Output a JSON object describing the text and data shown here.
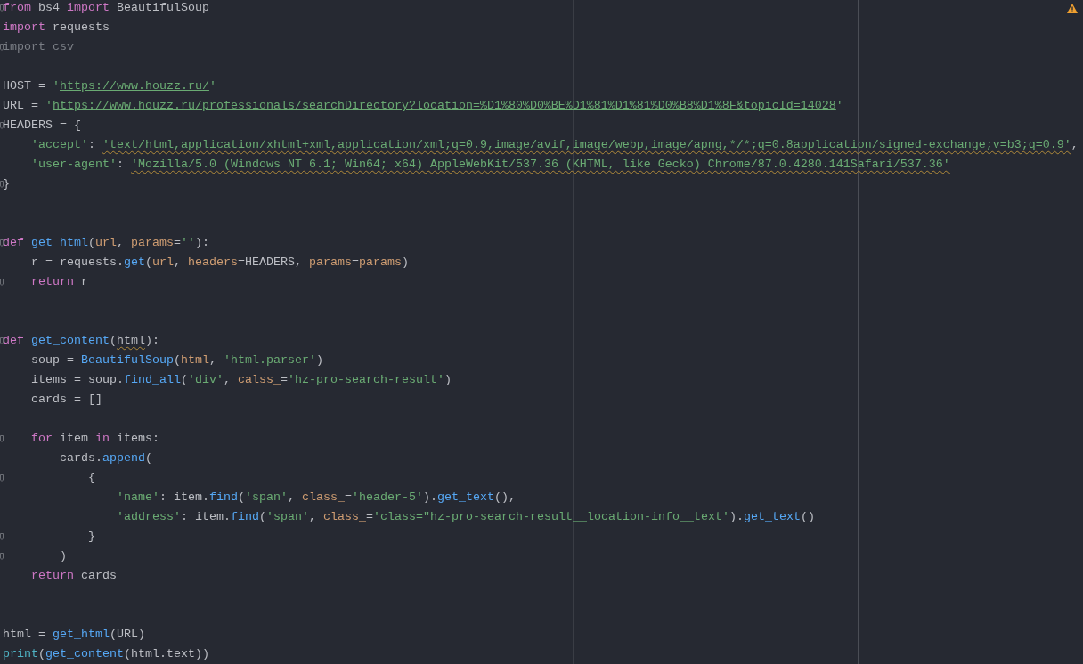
{
  "editor": {
    "lines": [
      {
        "kind": "code",
        "fold": true,
        "tokens": [
          {
            "kind": "kw",
            "text": "from"
          },
          {
            "kind": "plain",
            "text": " bs4 "
          },
          {
            "kind": "kw",
            "text": "import"
          },
          {
            "kind": "plain",
            "text": " BeautifulSoup"
          }
        ]
      },
      {
        "kind": "code",
        "fold": false,
        "tokens": [
          {
            "kind": "kw",
            "text": "import"
          },
          {
            "kind": "plain",
            "text": " requests"
          }
        ]
      },
      {
        "kind": "code",
        "fold": true,
        "tokens": [
          {
            "kind": "dim",
            "text": "import csv"
          }
        ]
      },
      {
        "kind": "blank"
      },
      {
        "kind": "code",
        "fold": false,
        "tokens": [
          {
            "kind": "plain",
            "text": "HOST = "
          },
          {
            "kind": "str",
            "text": "'"
          },
          {
            "kind": "link",
            "text": "https://www.houzz.ru/"
          },
          {
            "kind": "str",
            "text": "'"
          }
        ]
      },
      {
        "kind": "code",
        "fold": false,
        "tokens": [
          {
            "kind": "plain",
            "text": "URL = "
          },
          {
            "kind": "str",
            "text": "'"
          },
          {
            "kind": "link",
            "text": "https://www.houzz.ru/professionals/searchDirectory?location=%D1%80%D0%BE%D1%81%D1%81%D0%B8%D1%8F&topicId=14028"
          },
          {
            "kind": "str",
            "text": "'"
          }
        ]
      },
      {
        "kind": "code",
        "fold": true,
        "tokens": [
          {
            "kind": "plain",
            "text": "HEADERS = {"
          }
        ]
      },
      {
        "kind": "code",
        "fold": false,
        "tokens": [
          {
            "kind": "str",
            "text": "    'accept'"
          },
          {
            "kind": "plain",
            "text": ": "
          },
          {
            "kind": "strw",
            "text": "'text/html,application/xhtml+xml,application/xml;q=0.9,image/avif,image/webp,image/apng,*/*;q=0.8application/signed-exchange;v=b3;q=0.9'"
          },
          {
            "kind": "plain",
            "text": ","
          }
        ]
      },
      {
        "kind": "code",
        "fold": false,
        "tokens": [
          {
            "kind": "str",
            "text": "    'user-agent'"
          },
          {
            "kind": "plain",
            "text": ": "
          },
          {
            "kind": "strw",
            "text": "'Mozilla/5.0 (Windows NT 6.1; Win64; x64) AppleWebKit/537.36 (KHTML, like Gecko) Chrome/87.0.4280.141Safari/537.36'"
          }
        ]
      },
      {
        "kind": "code",
        "fold": true,
        "tokens": [
          {
            "kind": "plain",
            "text": "}"
          }
        ]
      },
      {
        "kind": "blank"
      },
      {
        "kind": "blank"
      },
      {
        "kind": "code",
        "fold": true,
        "tokens": [
          {
            "kind": "kw",
            "text": "def "
          },
          {
            "kind": "func",
            "text": "get_html"
          },
          {
            "kind": "plain",
            "text": "("
          },
          {
            "kind": "param",
            "text": "url"
          },
          {
            "kind": "plain",
            "text": ", "
          },
          {
            "kind": "param",
            "text": "params"
          },
          {
            "kind": "plain",
            "text": "="
          },
          {
            "kind": "str",
            "text": "''"
          },
          {
            "kind": "plain",
            "text": "):"
          }
        ]
      },
      {
        "kind": "code",
        "fold": false,
        "tokens": [
          {
            "kind": "plain",
            "text": "    r = requests."
          },
          {
            "kind": "func",
            "text": "get"
          },
          {
            "kind": "plain",
            "text": "("
          },
          {
            "kind": "param",
            "text": "url"
          },
          {
            "kind": "plain",
            "text": ", "
          },
          {
            "kind": "param",
            "text": "headers"
          },
          {
            "kind": "plain",
            "text": "=HEADERS, "
          },
          {
            "kind": "param",
            "text": "params"
          },
          {
            "kind": "plain",
            "text": "="
          },
          {
            "kind": "param",
            "text": "params"
          },
          {
            "kind": "plain",
            "text": ")"
          }
        ]
      },
      {
        "kind": "code",
        "fold": true,
        "tokens": [
          {
            "kind": "kw",
            "text": "    return"
          },
          {
            "kind": "plain",
            "text": " r"
          }
        ]
      },
      {
        "kind": "blank"
      },
      {
        "kind": "blank"
      },
      {
        "kind": "code",
        "fold": true,
        "tokens": [
          {
            "kind": "kw",
            "text": "def "
          },
          {
            "kind": "func",
            "text": "get_content"
          },
          {
            "kind": "plain",
            "text": "("
          },
          {
            "kind": "paramw",
            "text": "html"
          },
          {
            "kind": "plain",
            "text": "):"
          }
        ]
      },
      {
        "kind": "code",
        "fold": false,
        "tokens": [
          {
            "kind": "plain",
            "text": "    soup = "
          },
          {
            "kind": "func",
            "text": "BeautifulSoup"
          },
          {
            "kind": "plain",
            "text": "("
          },
          {
            "kind": "param",
            "text": "html"
          },
          {
            "kind": "plain",
            "text": ", "
          },
          {
            "kind": "str",
            "text": "'html.parser'"
          },
          {
            "kind": "plain",
            "text": ")"
          }
        ]
      },
      {
        "kind": "code",
        "fold": false,
        "tokens": [
          {
            "kind": "plain",
            "text": "    items = soup."
          },
          {
            "kind": "func",
            "text": "find_all"
          },
          {
            "kind": "plain",
            "text": "("
          },
          {
            "kind": "str",
            "text": "'div'"
          },
          {
            "kind": "plain",
            "text": ", "
          },
          {
            "kind": "param",
            "text": "calss_"
          },
          {
            "kind": "plain",
            "text": "="
          },
          {
            "kind": "str",
            "text": "'hz-pro-search-result'"
          },
          {
            "kind": "plain",
            "text": ")"
          }
        ]
      },
      {
        "kind": "code",
        "fold": false,
        "tokens": [
          {
            "kind": "plain",
            "text": "    cards = []"
          }
        ]
      },
      {
        "kind": "blank"
      },
      {
        "kind": "code",
        "fold": true,
        "tokens": [
          {
            "kind": "kw",
            "text": "    for"
          },
          {
            "kind": "plain",
            "text": " item "
          },
          {
            "kind": "kw",
            "text": "in"
          },
          {
            "kind": "plain",
            "text": " items:"
          }
        ]
      },
      {
        "kind": "code",
        "fold": false,
        "tokens": [
          {
            "kind": "plain",
            "text": "        cards."
          },
          {
            "kind": "func",
            "text": "append"
          },
          {
            "kind": "plain",
            "text": "("
          }
        ]
      },
      {
        "kind": "code",
        "fold": true,
        "tokens": [
          {
            "kind": "plain",
            "text": "            {"
          }
        ]
      },
      {
        "kind": "code",
        "fold": false,
        "tokens": [
          {
            "kind": "str",
            "text": "                'name'"
          },
          {
            "kind": "plain",
            "text": ": item."
          },
          {
            "kind": "func",
            "text": "find"
          },
          {
            "kind": "plain",
            "text": "("
          },
          {
            "kind": "str",
            "text": "'span'"
          },
          {
            "kind": "plain",
            "text": ", "
          },
          {
            "kind": "param",
            "text": "class_"
          },
          {
            "kind": "plain",
            "text": "="
          },
          {
            "kind": "str",
            "text": "'header-5'"
          },
          {
            "kind": "plain",
            "text": ")."
          },
          {
            "kind": "func",
            "text": "get_text"
          },
          {
            "kind": "plain",
            "text": "(),"
          }
        ]
      },
      {
        "kind": "code",
        "fold": false,
        "tokens": [
          {
            "kind": "str",
            "text": "                'address'"
          },
          {
            "kind": "plain",
            "text": ": item."
          },
          {
            "kind": "func",
            "text": "find"
          },
          {
            "kind": "plain",
            "text": "("
          },
          {
            "kind": "str",
            "text": "'span'"
          },
          {
            "kind": "plain",
            "text": ", "
          },
          {
            "kind": "param",
            "text": "class_"
          },
          {
            "kind": "plain",
            "text": "="
          },
          {
            "kind": "str",
            "text": "'class=\"hz-pro-search-result__location-info__text'"
          },
          {
            "kind": "plain",
            "text": ")."
          },
          {
            "kind": "func",
            "text": "get_text"
          },
          {
            "kind": "plain",
            "text": "()"
          }
        ]
      },
      {
        "kind": "code",
        "fold": true,
        "tokens": [
          {
            "kind": "plain",
            "text": "            }"
          }
        ]
      },
      {
        "kind": "code",
        "fold": true,
        "tokens": [
          {
            "kind": "plain",
            "text": "        )"
          }
        ]
      },
      {
        "kind": "code",
        "fold": false,
        "tokens": [
          {
            "kind": "kw",
            "text": "    return"
          },
          {
            "kind": "plain",
            "text": " cards"
          }
        ]
      },
      {
        "kind": "blank"
      },
      {
        "kind": "blank"
      },
      {
        "kind": "code",
        "fold": false,
        "tokens": [
          {
            "kind": "plain",
            "text": "html = "
          },
          {
            "kind": "func",
            "text": "get_html"
          },
          {
            "kind": "plain",
            "text": "(URL)"
          }
        ]
      },
      {
        "kind": "code",
        "fold": false,
        "tokens": [
          {
            "kind": "builtin",
            "text": "print"
          },
          {
            "kind": "plain",
            "text": "("
          },
          {
            "kind": "func",
            "text": "get_content"
          },
          {
            "kind": "plain",
            "text": "(html.text))"
          }
        ]
      }
    ]
  }
}
